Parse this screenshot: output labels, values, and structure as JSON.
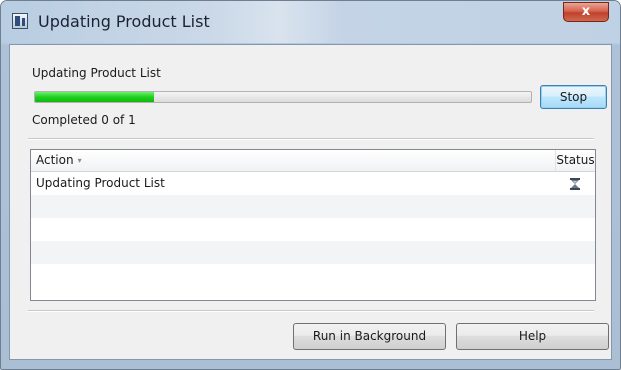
{
  "window": {
    "title": "Updating Product List",
    "close_glyph": "x",
    "app_icon": "app-icon"
  },
  "progress": {
    "label": "Updating Product List",
    "fraction": 0.24,
    "fill_color": "#1fd01f",
    "status_text": "Completed 0 of 1",
    "stop_label": "Stop"
  },
  "table": {
    "columns": [
      {
        "label": "Action",
        "sort_indicator": "▾"
      },
      {
        "label": "Status"
      }
    ],
    "rows": [
      {
        "action": "Updating Product List",
        "status_icon": "hourglass-icon"
      },
      {
        "action": "",
        "status_icon": ""
      },
      {
        "action": "",
        "status_icon": ""
      },
      {
        "action": "",
        "status_icon": ""
      },
      {
        "action": "",
        "status_icon": ""
      }
    ]
  },
  "footer": {
    "run_background_label": "Run in Background",
    "help_label": "Help"
  }
}
